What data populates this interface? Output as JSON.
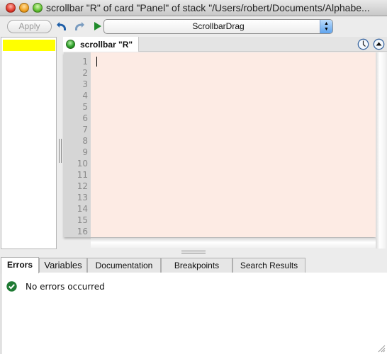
{
  "window": {
    "title": "scrollbar \"R\" of card \"Panel\" of stack \"/Users/robert/Documents/Alphabe..."
  },
  "toolbar": {
    "apply_label": "Apply",
    "handler_select_value": "ScrollbarDrag",
    "icons": [
      "undo-icon",
      "redo-icon",
      "run-icon",
      "select-arrows-icon"
    ]
  },
  "handler_list": {
    "selected_highlight_color": "#ffff00"
  },
  "script_tab": {
    "label": "scrollbar \"R\"",
    "status": "green"
  },
  "editor": {
    "background_color": "#fdebe4",
    "line_numbers": [
      "1",
      "2",
      "3",
      "4",
      "5",
      "6",
      "7",
      "8",
      "9",
      "10",
      "11",
      "12",
      "13",
      "14",
      "15",
      "16"
    ],
    "content": ""
  },
  "bottom_pane": {
    "tabs": [
      {
        "label": "Errors",
        "active": true
      },
      {
        "label": "Variables",
        "active": false
      },
      {
        "label": "Documentation",
        "active": false
      },
      {
        "label": "Breakpoints",
        "active": false
      },
      {
        "label": "Search Results",
        "active": false
      }
    ],
    "message": "No errors occurred"
  }
}
